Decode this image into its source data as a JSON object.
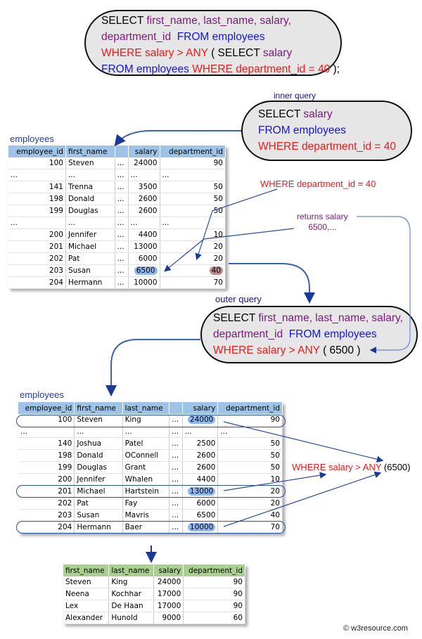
{
  "main_query": {
    "line1": [
      {
        "t": "SELECT ",
        "c": "k"
      },
      {
        "t": "first_name, last_name, salary,",
        "c": "p"
      }
    ],
    "line2": [
      {
        "t": "department_id  ",
        "c": "p"
      },
      {
        "t": "FROM employees",
        "c": "b"
      }
    ],
    "line3": [
      {
        "t": "WHERE salary > ANY ",
        "c": "r"
      },
      {
        "t": "( SELECT ",
        "c": "k"
      },
      {
        "t": "salary",
        "c": "p"
      }
    ],
    "line4": [
      {
        "t": "FROM employees ",
        "c": "b"
      },
      {
        "t": "WHERE department_id = 40 ",
        "c": "r"
      },
      {
        "t": ");",
        "c": "k"
      }
    ]
  },
  "inner_query": {
    "label": "inner query",
    "line1": [
      {
        "t": "SELECT ",
        "c": "k"
      },
      {
        "t": "salary",
        "c": "p"
      }
    ],
    "line2": [
      {
        "t": "FROM employees",
        "c": "b"
      }
    ],
    "line3": [
      {
        "t": "WHERE department_id = 40",
        "c": "r"
      }
    ]
  },
  "outer_query": {
    "label": "outer query",
    "line1": [
      {
        "t": "SELECT ",
        "c": "k"
      },
      {
        "t": "first_name, last_name, salary,",
        "c": "p"
      }
    ],
    "line2": [
      {
        "t": "department_id  ",
        "c": "p"
      },
      {
        "t": "FROM employees",
        "c": "b"
      }
    ],
    "line3": [
      {
        "t": "WHERE salary > ANY ",
        "c": "r"
      },
      {
        "t": "( 6500 )",
        "c": "k"
      }
    ]
  },
  "annotations": {
    "where_dept": "WHERE department_id = 40",
    "returns_line1": "returns salary",
    "returns_line2": "6500,...",
    "where_any": "WHERE salary > ANY",
    "where_any_value": "(6500)"
  },
  "table1": {
    "label": "employees",
    "columns": [
      "employee_id",
      "first_name",
      "",
      "salary",
      "department_id"
    ],
    "rows": [
      [
        "100",
        "Steven",
        "...",
        "24000",
        "90"
      ],
      [
        "...",
        "...",
        "...",
        "...",
        "..."
      ],
      [
        "141",
        "Trenna",
        "...",
        "3500",
        "50"
      ],
      [
        "198",
        "Donald",
        "...",
        "2600",
        "50"
      ],
      [
        "199",
        "Douglas",
        "...",
        "2600",
        "50"
      ],
      [
        "...",
        "...",
        "...",
        "...",
        "..."
      ],
      [
        "200",
        "Jennifer",
        "...",
        "4400",
        "10"
      ],
      [
        "201",
        "Michael",
        "...",
        "13000",
        "20"
      ],
      [
        "202",
        "Pat",
        "...",
        "6000",
        "20"
      ],
      [
        "203",
        "Susan",
        "...",
        "6500",
        "40"
      ],
      [
        "204",
        "Hermann",
        "...",
        "10000",
        "70"
      ]
    ]
  },
  "table2": {
    "label": "employees",
    "columns": [
      "employee_id",
      "first_name",
      "last_name",
      "",
      "salary",
      "department_id"
    ],
    "rows": [
      [
        "100",
        "Steven",
        "King",
        "...",
        "24000",
        "90"
      ],
      [
        "...",
        "...",
        "...",
        "...",
        "...",
        "..."
      ],
      [
        "140",
        "Joshua",
        "Patel",
        "...",
        "2500",
        "50"
      ],
      [
        "198",
        "Donald",
        "OConnell",
        "...",
        "2600",
        "50"
      ],
      [
        "199",
        "Douglas",
        "Grant",
        "...",
        "2600",
        "50"
      ],
      [
        "200",
        "Jennifer",
        "Whalen",
        "...",
        "4400",
        "10"
      ],
      [
        "201",
        "Michael",
        "Hartstein",
        "...",
        "13000",
        "20"
      ],
      [
        "202",
        "Pat",
        "Fay",
        "...",
        "6000",
        "20"
      ],
      [
        "203",
        "Susan",
        "Mavris",
        "...",
        "6500",
        "40"
      ],
      [
        "204",
        "Hermann",
        "Baer",
        "...",
        "10000",
        "70"
      ]
    ]
  },
  "result": {
    "columns": [
      "first_name",
      "last_name",
      "salary",
      "department_id"
    ],
    "rows": [
      [
        "Steven",
        "King",
        "24000",
        "90"
      ],
      [
        "Neena",
        "Kochhar",
        "17000",
        "90"
      ],
      [
        "Lex",
        "De Haan",
        "17000",
        "90"
      ],
      [
        "Alexander",
        "Hunold",
        "9000",
        "60"
      ]
    ]
  },
  "copyright": "© w3resource.com",
  "colors": {
    "highlight_blue": "#8fb8ef",
    "highlight_brown": "#b78c8c",
    "arrow": "#2a4fa0",
    "header_blue": "#9fc3e7",
    "header_green": "#a9d08e"
  }
}
